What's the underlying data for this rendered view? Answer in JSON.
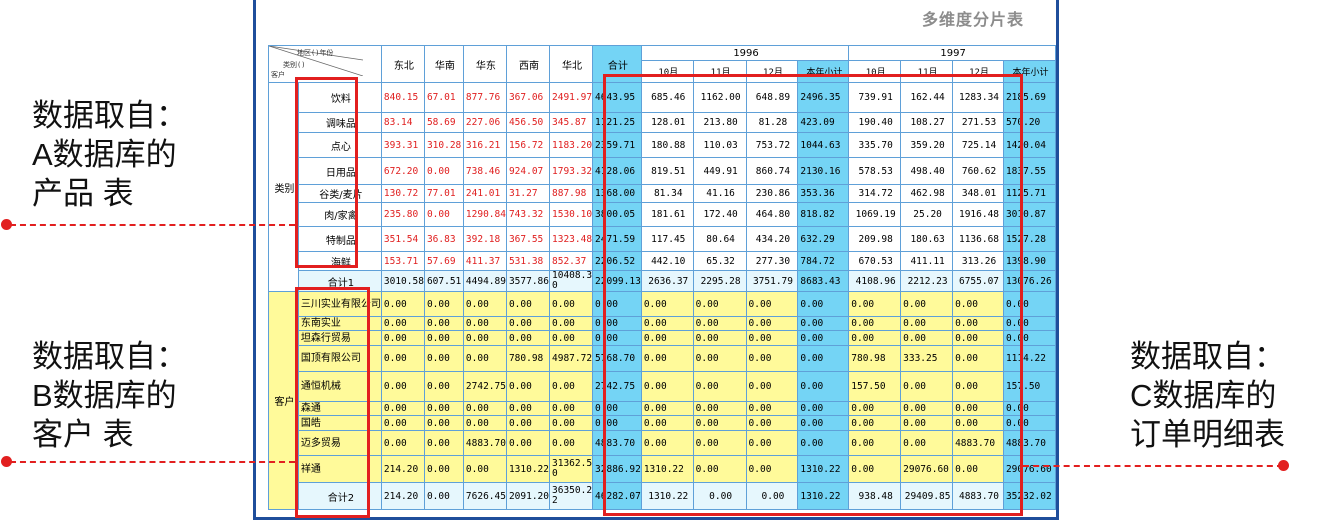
{
  "report_title": "多维度分片表",
  "corner": {
    "line1": "地区()年份",
    "line2": "类别()",
    "line3": "客户"
  },
  "regions": [
    "东北",
    "华南",
    "华东",
    "西南",
    "华北"
  ],
  "total_label": "合计",
  "years": [
    "1996",
    "1997"
  ],
  "months": [
    "10月",
    "11月",
    "12月",
    "本年小计"
  ],
  "group_category": "类别",
  "group_customer": "客户",
  "category_rows": [
    {
      "label": "饮料",
      "r": [
        "840.15",
        "67.01",
        "877.76",
        "367.06",
        "2491.97"
      ],
      "t": "4643.95",
      "y1996": [
        "685.46",
        "1162.00",
        "648.89",
        "2496.35"
      ],
      "y1997": [
        "739.91",
        "162.44",
        "1283.34",
        "2185.69"
      ]
    },
    {
      "label": "调味品",
      "r": [
        "83.14",
        "58.69",
        "227.06",
        "456.50",
        "345.87"
      ],
      "t": "1121.25",
      "y1996": [
        "128.01",
        "213.80",
        "81.28",
        "423.09"
      ],
      "y1997": [
        "190.40",
        "108.27",
        "271.53",
        "570.20"
      ]
    },
    {
      "label": "点心",
      "r": [
        "393.31",
        "310.28",
        "316.21",
        "156.72",
        "1183.20"
      ],
      "t": "2359.71",
      "y1996": [
        "180.88",
        "110.03",
        "753.72",
        "1044.63"
      ],
      "y1997": [
        "335.70",
        "359.20",
        "725.14",
        "1420.04"
      ]
    },
    {
      "label": "日用品",
      "r": [
        "672.20",
        "0.00",
        "738.46",
        "924.07",
        "1793.32"
      ],
      "t": "4128.06",
      "y1996": [
        "819.51",
        "449.91",
        "860.74",
        "2130.16"
      ],
      "y1997": [
        "578.53",
        "498.40",
        "760.62",
        "1837.55"
      ]
    },
    {
      "label": "谷类/麦片",
      "r": [
        "130.72",
        "77.01",
        "241.01",
        "31.27",
        "887.98"
      ],
      "t": "1368.00",
      "y1996": [
        "81.34",
        "41.16",
        "230.86",
        "353.36"
      ],
      "y1997": [
        "314.72",
        "462.98",
        "348.01",
        "1125.71"
      ]
    },
    {
      "label": "肉/家禽",
      "r": [
        "235.80",
        "0.00",
        "1290.84",
        "743.32",
        "1530.10"
      ],
      "t": "3800.05",
      "y1996": [
        "181.61",
        "172.40",
        "464.80",
        "818.82"
      ],
      "y1997": [
        "1069.19",
        "25.20",
        "1916.48",
        "3010.87"
      ]
    },
    {
      "label": "特制品",
      "r": [
        "351.54",
        "36.83",
        "392.18",
        "367.55",
        "1323.48"
      ],
      "t": "2471.59",
      "y1996": [
        "117.45",
        "80.64",
        "434.20",
        "632.29"
      ],
      "y1997": [
        "209.98",
        "180.63",
        "1136.68",
        "1527.28"
      ]
    },
    {
      "label": "海鲜",
      "r": [
        "153.71",
        "57.69",
        "411.37",
        "531.38",
        "852.37"
      ],
      "t": "2206.52",
      "y1996": [
        "442.10",
        "65.32",
        "277.30",
        "784.72"
      ],
      "y1997": [
        "670.53",
        "411.11",
        "313.26",
        "1398.90"
      ]
    }
  ],
  "sum1": {
    "label": "合计1",
    "r": [
      "3010.58",
      "607.51",
      "4494.89",
      "3577.86",
      "10408.30"
    ],
    "t": "22099.13",
    "y1996": [
      "2636.37",
      "2295.28",
      "3751.79",
      "8683.43"
    ],
    "y1997": [
      "4108.96",
      "2212.23",
      "6755.07",
      "13076.26"
    ]
  },
  "customer_rows": [
    {
      "label": "三川实业有限公司",
      "r": [
        "0.00",
        "0.00",
        "0.00",
        "0.00",
        "0.00"
      ],
      "t": "0.00",
      "y1996": [
        "0.00",
        "0.00",
        "0.00",
        "0.00"
      ],
      "y1997": [
        "0.00",
        "0.00",
        "0.00",
        "0.00"
      ]
    },
    {
      "label": "东南实业",
      "r": [
        "0.00",
        "0.00",
        "0.00",
        "0.00",
        "0.00"
      ],
      "t": "0.00",
      "y1996": [
        "0.00",
        "0.00",
        "0.00",
        "0.00"
      ],
      "y1997": [
        "0.00",
        "0.00",
        "0.00",
        "0.00"
      ]
    },
    {
      "label": "坦森行贸易",
      "r": [
        "0.00",
        "0.00",
        "0.00",
        "0.00",
        "0.00"
      ],
      "t": "0.00",
      "y1996": [
        "0.00",
        "0.00",
        "0.00",
        "0.00"
      ],
      "y1997": [
        "0.00",
        "0.00",
        "0.00",
        "0.00"
      ]
    },
    {
      "label": "国顶有限公司",
      "r": [
        "0.00",
        "0.00",
        "0.00",
        "780.98",
        "4987.72"
      ],
      "t": "5768.70",
      "y1996": [
        "0.00",
        "0.00",
        "0.00",
        "0.00"
      ],
      "y1997": [
        "780.98",
        "333.25",
        "0.00",
        "1114.22"
      ]
    },
    {
      "label": "通恒机械",
      "r": [
        "0.00",
        "0.00",
        "2742.75",
        "0.00",
        "0.00"
      ],
      "t": "2742.75",
      "y1996": [
        "0.00",
        "0.00",
        "0.00",
        "0.00"
      ],
      "y1997": [
        "157.50",
        "0.00",
        "0.00",
        "157.50"
      ]
    },
    {
      "label": "森通",
      "r": [
        "0.00",
        "0.00",
        "0.00",
        "0.00",
        "0.00"
      ],
      "t": "0.00",
      "y1996": [
        "0.00",
        "0.00",
        "0.00",
        "0.00"
      ],
      "y1997": [
        "0.00",
        "0.00",
        "0.00",
        "0.00"
      ]
    },
    {
      "label": "国皓",
      "r": [
        "0.00",
        "0.00",
        "0.00",
        "0.00",
        "0.00"
      ],
      "t": "0.00",
      "y1996": [
        "0.00",
        "0.00",
        "0.00",
        "0.00"
      ],
      "y1997": [
        "0.00",
        "0.00",
        "0.00",
        "0.00"
      ]
    },
    {
      "label": "迈多贸易",
      "r": [
        "0.00",
        "0.00",
        "4883.70",
        "0.00",
        "0.00"
      ],
      "t": "4883.70",
      "y1996": [
        "0.00",
        "0.00",
        "0.00",
        "0.00"
      ],
      "y1997": [
        "0.00",
        "0.00",
        "4883.70",
        "4883.70"
      ]
    },
    {
      "label": "祥通",
      "r": [
        "214.20",
        "0.00",
        "0.00",
        "1310.22",
        "31362.50"
      ],
      "t": "32886.92",
      "y1996": [
        "1310.22",
        "0.00",
        "0.00",
        "1310.22"
      ],
      "y1997": [
        "0.00",
        "29076.60",
        "0.00",
        "29076.60"
      ]
    }
  ],
  "sum2": {
    "label": "合计2",
    "r": [
      "214.20",
      "0.00",
      "7626.45",
      "2091.20",
      "36350.22"
    ],
    "t": "46282.07",
    "y1996": [
      "1310.22",
      "0.00",
      "0.00",
      "1310.22"
    ],
    "y1997": [
      "938.48",
      "29409.85",
      "4883.70",
      "35232.02"
    ]
  },
  "annotations": {
    "a": [
      "数据取自：",
      "A数据库的",
      "产品 表"
    ],
    "b": [
      "数据取自：",
      "B数据库的",
      "客户 表"
    ],
    "c": [
      "数据取自：",
      "C数据库的",
      "订单明细表"
    ]
  },
  "colors": {
    "frame": "#1f4e9b",
    "highlight": "#e21f1f",
    "total_col": "#74d4f5",
    "customer_bg": "#fffa9a",
    "red_text": "#e02020"
  }
}
